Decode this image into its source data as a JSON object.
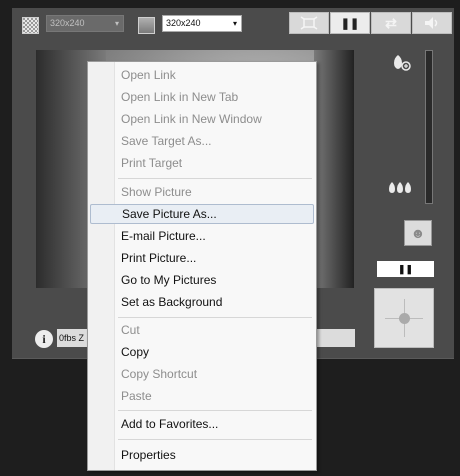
{
  "toolbar": {
    "resolution_primary": "320x240",
    "resolution_secondary": "320x240",
    "dropdown_arrow": "▾",
    "pause_symbol": "❚❚",
    "buttons": [
      "fit-screen-icon",
      "pause-icon",
      "swap-icon",
      "speaker-icon"
    ]
  },
  "side": {
    "pause_symbol": "❚❚"
  },
  "status": {
    "text": "0fbs Z",
    "info_symbol": "i"
  },
  "menu": {
    "items": [
      {
        "label": "Open Link",
        "disabled": true
      },
      {
        "label": "Open Link in New Tab",
        "disabled": true
      },
      {
        "label": "Open Link in New Window",
        "disabled": true
      },
      {
        "label": "Save Target As...",
        "disabled": true
      },
      {
        "label": "Print Target",
        "disabled": true
      },
      {
        "label": "Show Picture",
        "disabled": true
      },
      {
        "label": "Save Picture As...",
        "disabled": false,
        "highlighted": true
      },
      {
        "label": "E-mail Picture...",
        "disabled": false
      },
      {
        "label": "Print Picture...",
        "disabled": false
      },
      {
        "label": "Go to My Pictures",
        "disabled": false
      },
      {
        "label": "Set as Background",
        "disabled": false
      },
      {
        "label": "Cut",
        "disabled": true
      },
      {
        "label": "Copy",
        "disabled": false
      },
      {
        "label": "Copy Shortcut",
        "disabled": true
      },
      {
        "label": "Paste",
        "disabled": true
      },
      {
        "label": "Add to Favorites...",
        "disabled": false
      },
      {
        "label": "Properties",
        "disabled": false
      }
    ]
  },
  "colors": {
    "panel": "#4b4b4b",
    "frame": "#1e1e1e",
    "menu_bg": "#f8f8f8",
    "menu_hover": "#e9eef4",
    "disabled_text": "#8d8d8d"
  }
}
